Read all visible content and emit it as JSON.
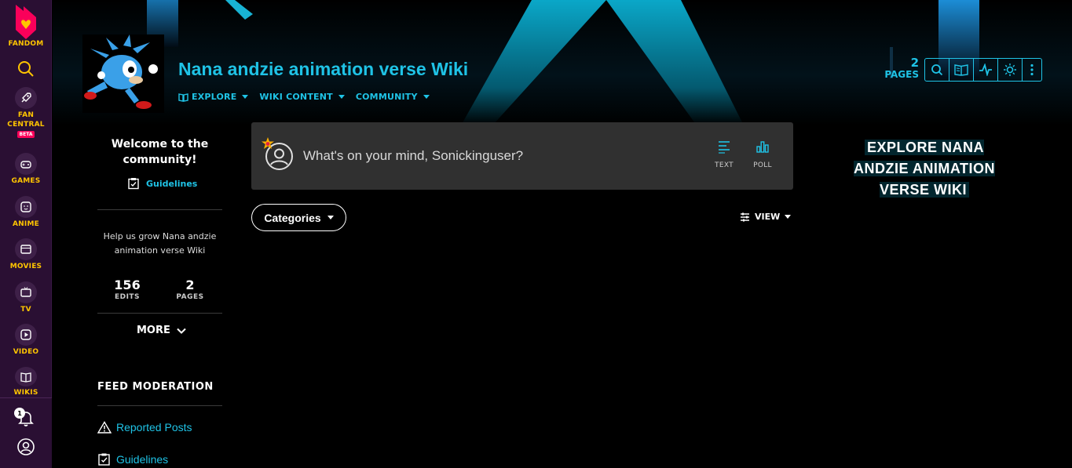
{
  "global_nav": {
    "brand_label": "FANDOM",
    "items": [
      {
        "label_lines": [
          "FAN",
          "CENTRAL"
        ],
        "icon": "rocket-icon",
        "badge": "BETA"
      },
      {
        "label": "GAMES",
        "icon": "gamepad-icon"
      },
      {
        "label": "ANIME",
        "icon": "anime-face-icon"
      },
      {
        "label": "MOVIES",
        "icon": "clapperboard-icon"
      },
      {
        "label": "TV",
        "icon": "tv-icon"
      },
      {
        "label": "VIDEO",
        "icon": "play-icon"
      },
      {
        "label": "WIKIS",
        "icon": "book-icon"
      }
    ],
    "notification_count": "1"
  },
  "wiki": {
    "title": "Nana andzie animation verse Wiki",
    "nav": [
      {
        "label": "EXPLORE"
      },
      {
        "label": "WIKI CONTENT"
      },
      {
        "label": "COMMUNITY"
      }
    ],
    "pages_count": "2",
    "pages_label": "PAGES"
  },
  "left_rail": {
    "welcome": "Welcome to the community!",
    "guidelines_link": "Guidelines",
    "help_text": "Help us grow Nana andzie animation verse Wiki",
    "stats": [
      {
        "value": "156",
        "label": "EDITS"
      },
      {
        "value": "2",
        "label": "PAGES"
      }
    ],
    "more_label": "MORE",
    "feed_moderation_title": "FEED MODERATION",
    "moderation_links": [
      {
        "label": "Reported Posts",
        "icon": "warning-icon"
      },
      {
        "label": "Guidelines",
        "icon": "checklist-icon"
      }
    ]
  },
  "composer": {
    "placeholder": "What's on your mind, Sonickinguser?",
    "text_label": "TEXT",
    "poll_label": "POLL"
  },
  "feed_controls": {
    "categories_label": "Categories",
    "view_label": "VIEW"
  },
  "right_rail": {
    "explore_title": "EXPLORE NANA ANDZIE ANIMATION VERSE WIKI"
  },
  "colors": {
    "accent": "#1fc3e6",
    "fandom_yellow": "#ffc500",
    "global_nav_bg": "#2a0f33",
    "composer_bg": "#303030"
  }
}
